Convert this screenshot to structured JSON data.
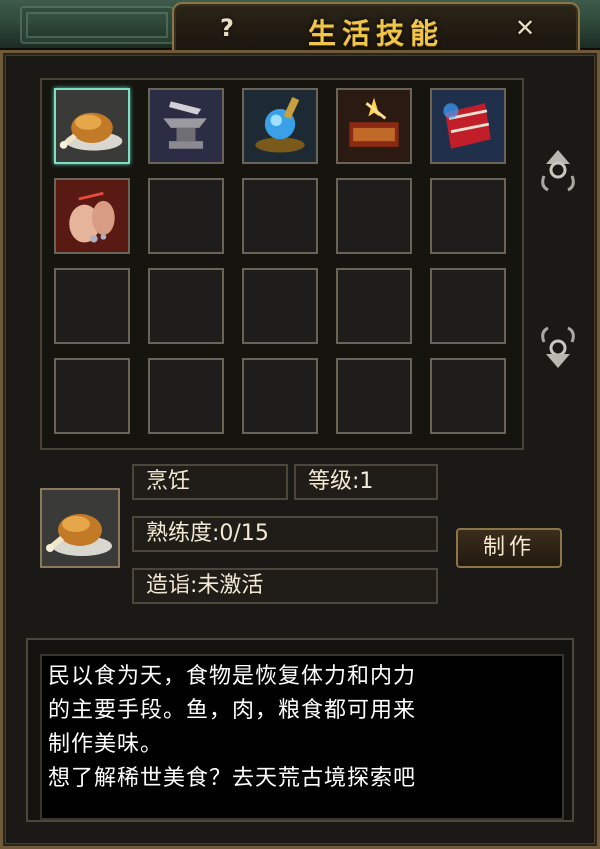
{
  "window": {
    "title": "生活技能",
    "help_label": "?",
    "close_label": "✕"
  },
  "skill_slots": [
    {
      "icon": "roast-chicken-icon",
      "selected": true
    },
    {
      "icon": "anvil-icon"
    },
    {
      "icon": "alchemy-flask-icon"
    },
    {
      "icon": "forge-icon"
    },
    {
      "icon": "silk-cloth-icon"
    },
    {
      "icon": "jewelry-craft-icon"
    },
    {},
    {},
    {},
    {},
    {},
    {},
    {},
    {},
    {},
    {},
    {},
    {},
    {},
    {}
  ],
  "selected_skill": {
    "icon": "roast-chicken-icon",
    "name": "烹饪",
    "level": "等级:1",
    "proficiency": "熟练度:0/15",
    "mastery": "造诣:未激活"
  },
  "make_button_label": "制作",
  "description": {
    "lines": [
      "民以食为天，食物是恢复体力和内力",
      "的主要手段。鱼，肉，粮食都可用来",
      "制作美味。",
      "想了解稀世美食？去天荒古境探索吧"
    ]
  },
  "colors": {
    "title": "#f0c64a",
    "slot_selected": "#7ee0c2"
  }
}
